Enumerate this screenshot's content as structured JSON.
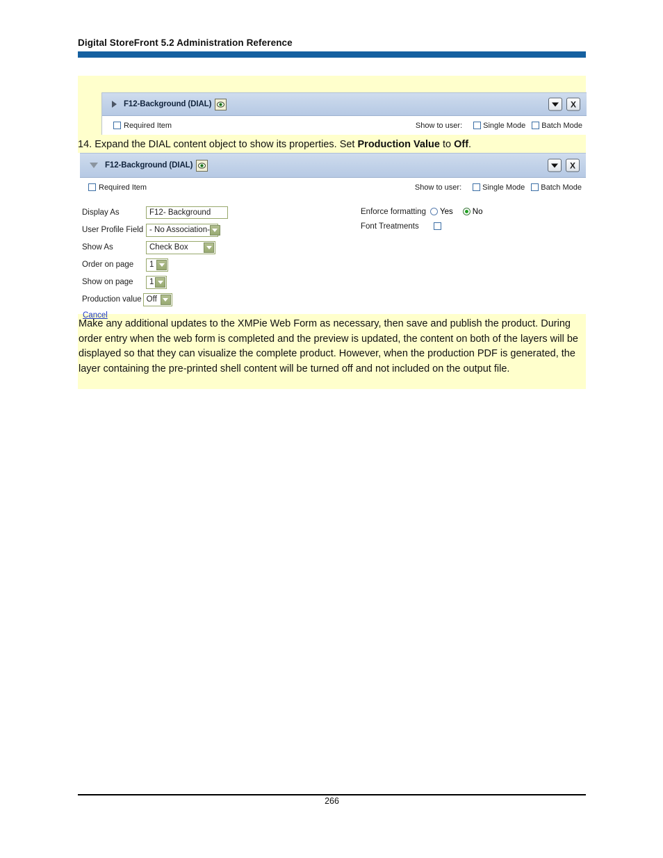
{
  "document": {
    "running_header": "Digital StoreFront 5.2 Administration Reference",
    "page_number": "266"
  },
  "step": {
    "number": "14.",
    "text_before": "Expand the DIAL content object to show its properties. Set",
    "bold_1": "Production Value",
    "text_middle": "to",
    "bold_2": "Off",
    "text_after": "."
  },
  "panel_collapsed": {
    "title": "F12-Background (DIAL)",
    "twisty": "triangle-right-icon",
    "eye_icon": "eye-icon",
    "menu_button": "chevron-down-icon",
    "close_button": "X",
    "required_item_label": "Required Item",
    "required_item_checked": false,
    "show_to_user_label": "Show to user:",
    "single_mode_label": "Single Mode",
    "single_mode_checked": false,
    "batch_mode_label": "Batch Mode",
    "batch_mode_checked": false
  },
  "panel_expanded": {
    "title": "F12-Background (DIAL)",
    "twisty": "triangle-down-icon",
    "eye_icon": "eye-icon",
    "menu_button": "chevron-down-icon",
    "close_button": "X",
    "required_item_label": "Required Item",
    "required_item_checked": false,
    "show_to_user_label": "Show to user:",
    "single_mode_label": "Single Mode",
    "single_mode_checked": false,
    "batch_mode_label": "Batch Mode",
    "batch_mode_checked": false,
    "fields": {
      "display_as_label": "Display As",
      "display_as_value": "F12- Background",
      "user_profile_field_label": "User Profile Field",
      "user_profile_field_value": "- No Association-",
      "show_as_label": "Show As",
      "show_as_value": "Check Box",
      "order_on_page_label": "Order on page",
      "order_on_page_value": "1",
      "show_on_page_label": "Show on page",
      "show_on_page_value": "1",
      "production_value_label": "Production value",
      "production_value_value": "Off",
      "cancel_label": "Cancel",
      "enforce_formatting_label": "Enforce formatting",
      "enforce_yes_label": "Yes",
      "enforce_no_label": "No",
      "enforce_selected": "No",
      "font_treatments_label": "Font Treatments",
      "font_treatments_checked": false
    }
  },
  "closing_paragraph": "Make any additional updates to the XMPie Web Form as necessary, then save and publish the product. During order entry when the web form is completed and the preview is updated, the content on both of the layers will be displayed so that they can visualize the complete product. However, when the production PDF is generated, the layer containing the pre-printed shell content will be turned off and not included on the output file.",
  "colors": {
    "header_rule": "#1560a0",
    "highlight": "#ffffcc",
    "panel_title_bar": "#c3d3e9",
    "select_accent": "#98aa72",
    "link": "#1b36c8",
    "radio_selected": "#23a023"
  }
}
